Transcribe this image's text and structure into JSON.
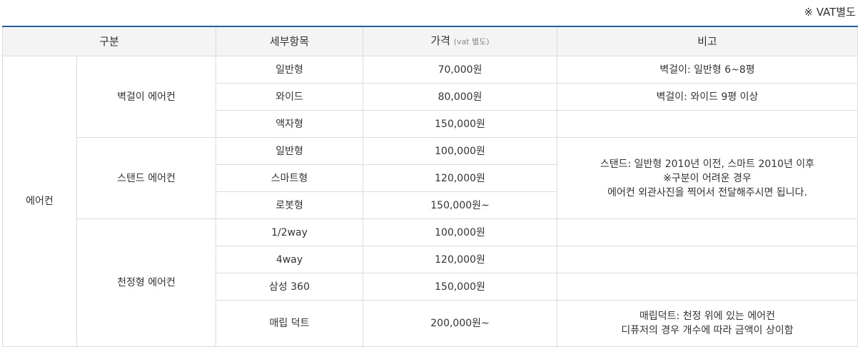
{
  "vat_note": "※ VAT별도",
  "headers": {
    "category": "구분",
    "detail": "세부항목",
    "price": "가격",
    "price_sub": "(vat 별도)",
    "remarks": "비고"
  },
  "category_main": "에어컨",
  "groups": [
    {
      "name": "벽걸이 에어컨",
      "items": [
        {
          "detail": "일반형",
          "price": "70,000원",
          "remark": "벽걸이: 일반형 6~8평"
        },
        {
          "detail": "와이드",
          "price": "80,000원",
          "remark": "벽걸이: 와이드 9평 이상"
        },
        {
          "detail": "액자형",
          "price": "150,000원",
          "remark": ""
        }
      ]
    },
    {
      "name": "스탠드 에어컨",
      "items": [
        {
          "detail": "일반형",
          "price": "100,000원"
        },
        {
          "detail": "스마트형",
          "price": "120,000원"
        },
        {
          "detail": "로봇형",
          "price": "150,000원~"
        }
      ],
      "remark_lines": [
        "스탠드: 일반형 2010년 이전, 스마트 2010년 이후",
        "※구분이 어려운 경우",
        "에어컨 외관사진을 찍어서 전달해주시면 됩니다."
      ]
    },
    {
      "name": "천정형 에어컨",
      "items": [
        {
          "detail": "1/2way",
          "price": "100,000원",
          "remark": ""
        },
        {
          "detail": "4way",
          "price": "120,000원",
          "remark": ""
        },
        {
          "detail": "삼성 360",
          "price": "150,000원",
          "remark": ""
        },
        {
          "detail": "매립 덕트",
          "price": "200,000원~",
          "remark_lines": [
            "매립덕트: 천정 위에 있는 에어컨",
            "디퓨저의 경우 개수에 따라 금액이 상이함"
          ]
        }
      ]
    }
  ]
}
